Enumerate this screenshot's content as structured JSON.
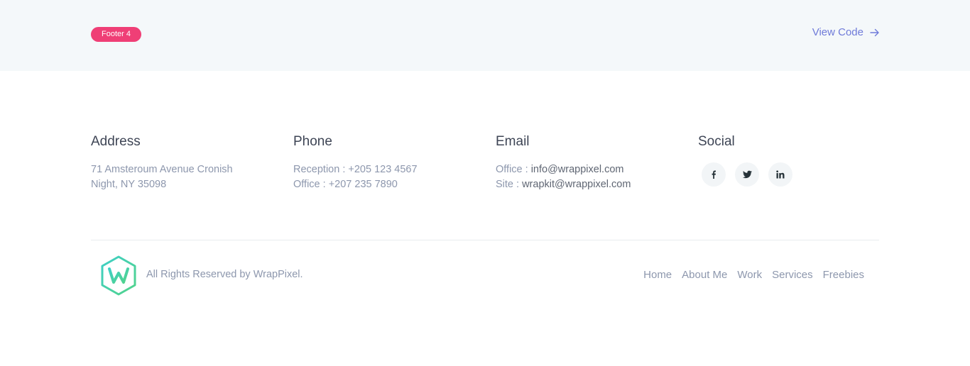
{
  "header": {
    "badge": "Footer 4",
    "view_code": "View Code",
    "colors": {
      "badge": "#ef3f76",
      "link": "#6f7bd9",
      "bar": "#f4f8fa"
    }
  },
  "columns": {
    "address": {
      "title": "Address",
      "line1": "71 Amsteroum Avenue Cronish",
      "line2": "Night, NY 35098"
    },
    "phone": {
      "title": "Phone",
      "line1": "Reception : +205 123 4567",
      "line2": "Office : +207 235 7890"
    },
    "email": {
      "title": "Email",
      "line1_label": "Office : ",
      "line1_value": "info@wrappixel.com",
      "line2_label": "Site : ",
      "line2_value": "wrapkit@wrappixel.com"
    },
    "social": {
      "title": "Social",
      "icons": [
        "facebook-icon",
        "twitter-icon",
        "linkedin-icon"
      ]
    }
  },
  "bottom": {
    "logo": "W",
    "copyright": "All Rights Reserved by WrapPixel.",
    "nav": [
      "Home",
      "About Me",
      "Work",
      "Services",
      "Freebies"
    ]
  }
}
